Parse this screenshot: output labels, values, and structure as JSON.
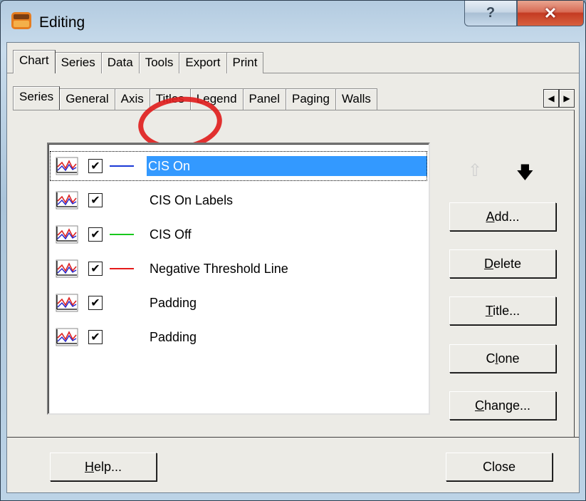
{
  "window": {
    "title": "Editing",
    "help_caption": "?",
    "close_caption": "✕"
  },
  "tabs_main": [
    "Chart",
    "Series",
    "Data",
    "Tools",
    "Export",
    "Print"
  ],
  "tabs_sub": [
    "Series",
    "General",
    "Axis",
    "Titles",
    "Legend",
    "Panel",
    "Paging",
    "Walls"
  ],
  "tab_scroll": {
    "left": "◀",
    "right": "▶"
  },
  "series_list": [
    {
      "label": "CIS On",
      "checked": true,
      "line_color": "#1a39d6",
      "selected": true
    },
    {
      "label": "CIS On Labels",
      "checked": true,
      "line_color": "",
      "selected": false
    },
    {
      "label": "CIS Off",
      "checked": true,
      "line_color": "#19c81d",
      "selected": false
    },
    {
      "label": "Negative Threshold Line",
      "checked": true,
      "line_color": "#e51a1a",
      "selected": false
    },
    {
      "label": "Padding",
      "checked": true,
      "line_color": "",
      "selected": false
    },
    {
      "label": "Padding",
      "checked": true,
      "line_color": "",
      "selected": false
    }
  ],
  "side_buttons": {
    "add": {
      "key": "A",
      "rest": "dd..."
    },
    "delete": {
      "key": "D",
      "rest": "elete"
    },
    "title": {
      "key": "T",
      "rest": "itle..."
    },
    "clone": {
      "pre": "C",
      "key": "l",
      "rest": "one"
    },
    "change": {
      "key": "C",
      "rest": "hange..."
    }
  },
  "move": {
    "up": "⇧",
    "down": "🡇"
  },
  "footer": {
    "help": {
      "key": "H",
      "rest": "elp..."
    },
    "close": "Close"
  },
  "colors": {
    "selection": "#3399ff",
    "annotation": "#e0201f"
  }
}
